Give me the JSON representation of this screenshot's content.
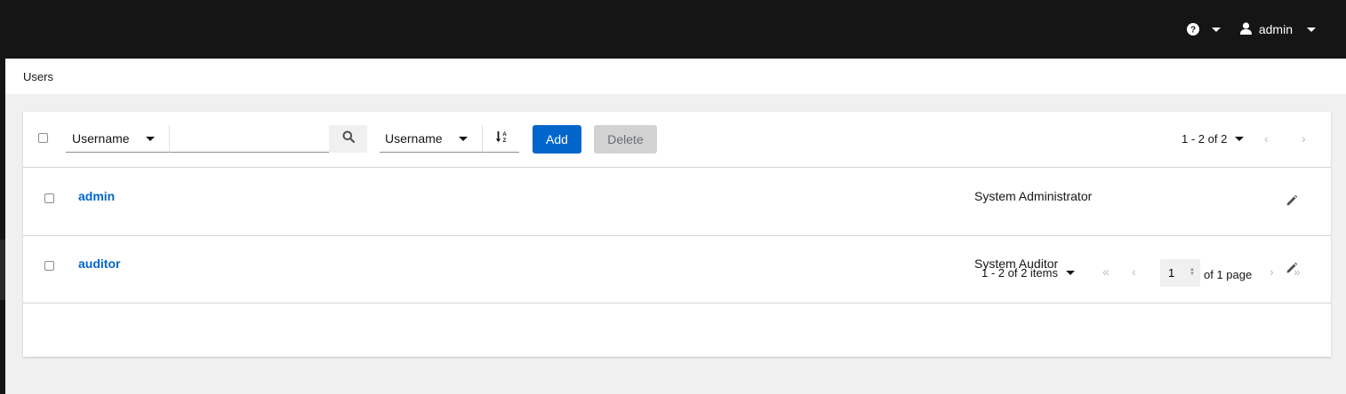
{
  "header": {
    "help_icon": "question-circle-icon",
    "user_icon": "user-icon",
    "username": "admin"
  },
  "breadcrumb": {
    "current": "Users"
  },
  "toolbar": {
    "filter_field": "Username",
    "search_placeholder": "",
    "sort_field": "Username",
    "add_label": "Add",
    "delete_label": "Delete",
    "pagination_summary": "1 - 2 of 2"
  },
  "users": [
    {
      "username": "admin",
      "role": "System Administrator"
    },
    {
      "username": "auditor",
      "role": "System Auditor"
    }
  ],
  "footer": {
    "items_summary": "1 - 2 of 2 items",
    "current_page": "1",
    "of_pages": "of 1 page"
  },
  "colors": {
    "topbar": "#151515",
    "primary": "#0066cc",
    "disabled": "#d2d2d2",
    "background": "#f0f0f0"
  }
}
